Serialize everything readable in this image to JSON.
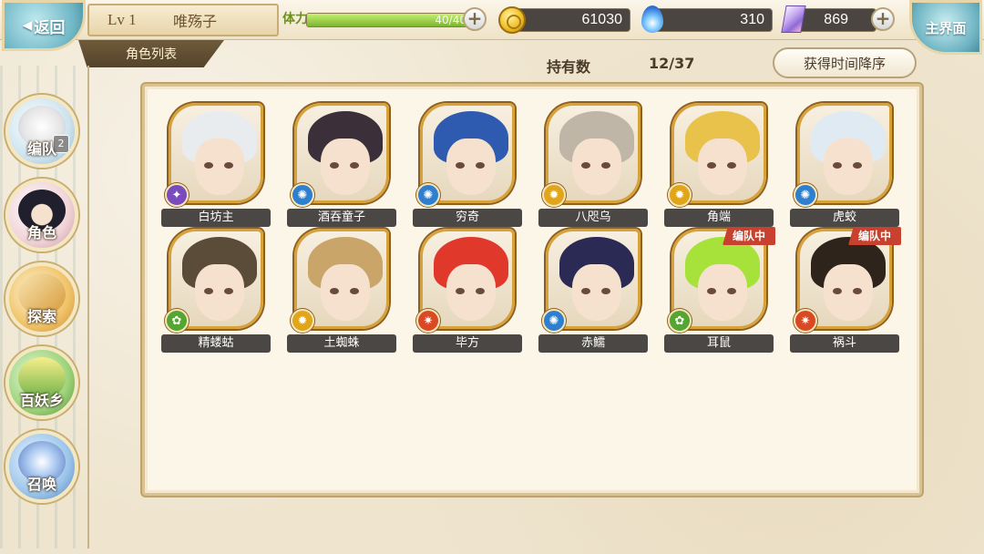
{
  "header": {
    "back_label": "返回",
    "level": "Lv 1",
    "player_name": "唯殇子",
    "section_tab": "角色列表",
    "stamina_label": "体力",
    "stamina_text": "40/40",
    "stamina_ratio": 1.0,
    "gold": "61030",
    "soul": "310",
    "crystal": "869",
    "main_menu_label": "主界面"
  },
  "toolbar": {
    "count_label": "持有数",
    "count_value": "12/37",
    "sort_label": "获得时间降序"
  },
  "sidebar": {
    "items": [
      {
        "label": "编队",
        "icon": "party-icon",
        "badge": "2"
      },
      {
        "label": "角色",
        "icon": "character-icon"
      },
      {
        "label": "探索",
        "icon": "explore-icon"
      },
      {
        "label": "百妖乡",
        "icon": "village-icon"
      },
      {
        "label": "召唤",
        "icon": "summon-icon"
      }
    ]
  },
  "characters": [
    {
      "name": "白坊主",
      "element": "purple",
      "hair": "#e9ecef",
      "in_party": false
    },
    {
      "name": "酒吞童子",
      "element": "blue",
      "hair": "#3b2f3a",
      "in_party": false
    },
    {
      "name": "穷奇",
      "element": "blue",
      "hair": "#2e5bb0",
      "in_party": false
    },
    {
      "name": "八咫乌",
      "element": "yellow",
      "hair": "#bfb6a8",
      "in_party": false
    },
    {
      "name": "角端",
      "element": "yellow",
      "hair": "#e8c24a",
      "in_party": false
    },
    {
      "name": "虎蛟",
      "element": "blue",
      "hair": "#dfeaf3",
      "in_party": false
    },
    {
      "name": "精蝼蛄",
      "element": "green",
      "hair": "#5b4c3a",
      "in_party": false
    },
    {
      "name": "土蜘蛛",
      "element": "yellow",
      "hair": "#c9a56a",
      "in_party": false
    },
    {
      "name": "毕方",
      "element": "red",
      "hair": "#e0382a",
      "in_party": false
    },
    {
      "name": "赤鱬",
      "element": "blue",
      "hair": "#2a2a55",
      "in_party": false
    },
    {
      "name": "耳鼠",
      "element": "green",
      "hair": "#a6e23a",
      "in_party": true
    },
    {
      "name": "祸斗",
      "element": "red",
      "hair": "#2f241c",
      "in_party": true
    }
  ],
  "party_tag_label": "编队中",
  "colors": {
    "element_purple": "#7a4bbd",
    "element_blue": "#2f7fd0",
    "element_yellow": "#e0a51a",
    "element_green": "#55a532",
    "element_red": "#d94a24",
    "accent_gold": "#d7a23b"
  }
}
